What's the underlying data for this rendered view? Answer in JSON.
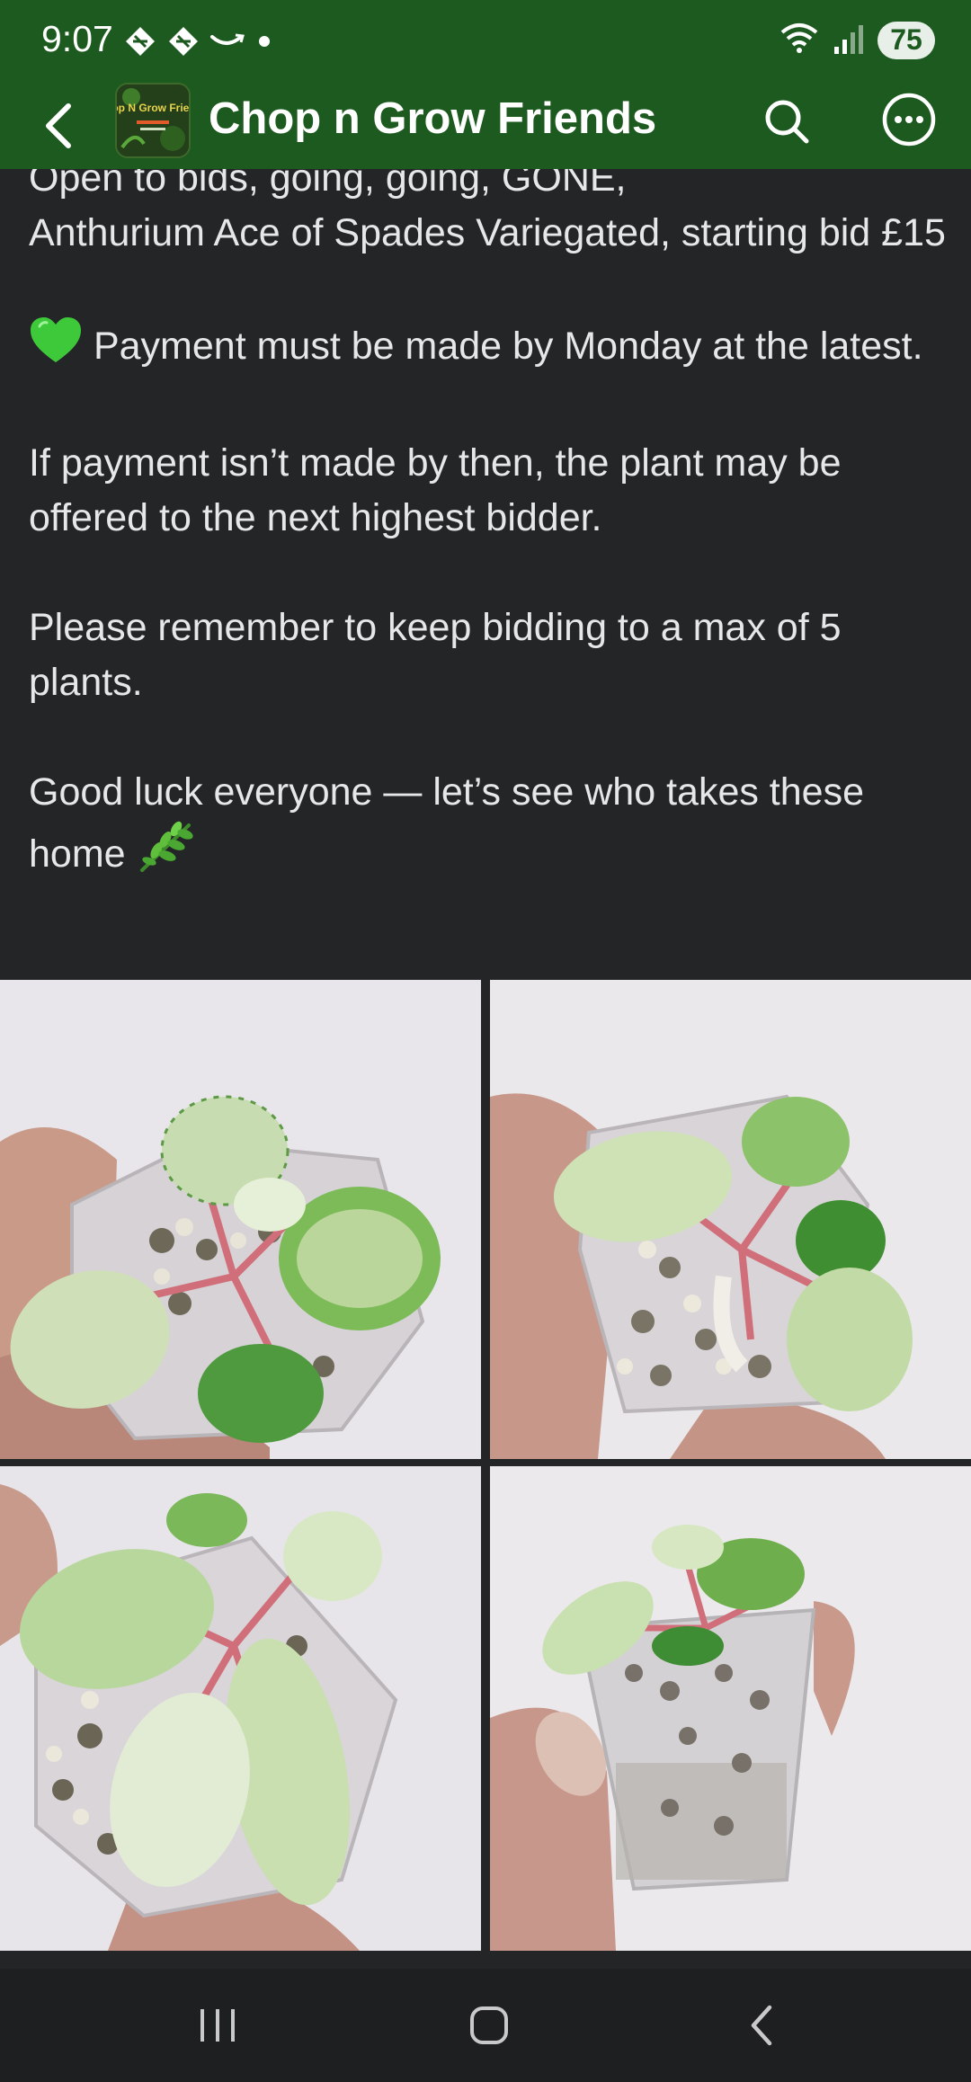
{
  "status_bar": {
    "time": "9:07",
    "battery": "75",
    "icons": [
      "notification-icon",
      "notification-icon",
      "amazon-smile-icon",
      "dot-icon",
      "wifi-icon",
      "signal-icon"
    ]
  },
  "app_bar": {
    "group_name": "Chop n Grow Friends",
    "logo_text": "Chop N Grow Friends",
    "colors": {
      "bar": "#1d5a1f",
      "background": "#242527",
      "text": "#e6e7e9"
    }
  },
  "post": {
    "paragraph_1_line_1": "Open to bids, going, going, GONE,",
    "paragraph_1_line_2": "Anthurium Ace of Spades Variegated, starting bid £15",
    "paragraph_2": "Payment must be made by Monday at the latest.",
    "paragraph_3": "If payment isn’t made by then, the plant may be offered to the next highest bidder.",
    "paragraph_4": "Please remember to keep bidding to a max of 5 plants.",
    "paragraph_5": "Good luck everyone — let’s see who takes these home",
    "emoji_heart": "green-heart-icon",
    "emoji_herb": "herb-icon"
  },
  "photos": [
    "anthurium-photo-1",
    "anthurium-photo-2",
    "anthurium-photo-3",
    "anthurium-photo-4"
  ],
  "nav": [
    "recents-icon",
    "home-icon",
    "back-icon"
  ]
}
